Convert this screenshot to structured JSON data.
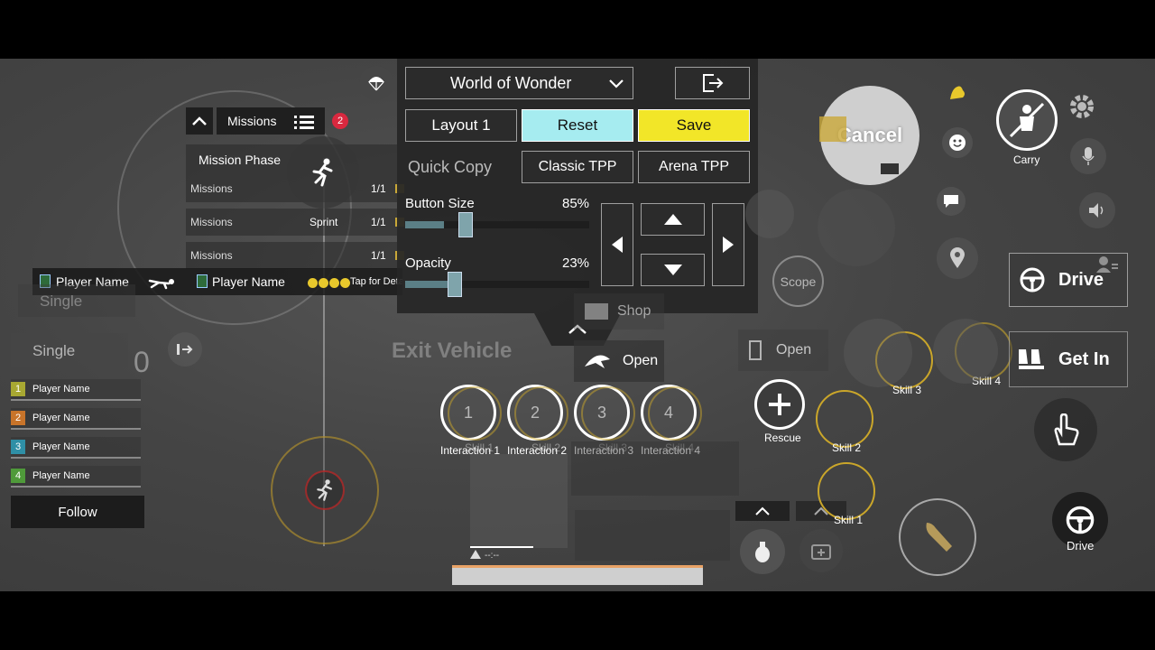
{
  "panel": {
    "map_select": "World of Wonder",
    "layout_label": "Layout 1",
    "reset_label": "Reset",
    "save_label": "Save",
    "quick_copy_label": "Quick Copy",
    "classic_tpp_label": "Classic TPP",
    "arena_tpp_label": "Arena TPP",
    "button_size_label": "Button Size",
    "button_size_value": "85%",
    "button_size_fraction": 0.85,
    "opacity_label": "Opacity",
    "opacity_value": "23%",
    "opacity_fraction": 0.23
  },
  "missions": {
    "tab_label": "Missions",
    "badge_count": "2",
    "phase_label": "Mission Phase",
    "rows": [
      {
        "label": "Missions",
        "progress": "1/1"
      },
      {
        "label": "Missions",
        "progress": "1/1"
      },
      {
        "label": "Missions",
        "progress": "1/1"
      }
    ],
    "sprint_label": "Sprint"
  },
  "teammates": {
    "top_left_name": "Player Name",
    "top_right_name": "Player Name",
    "tap_details": "Tap for Deta",
    "list": [
      {
        "num": "1",
        "name": "Player Name",
        "color": "#a8a832"
      },
      {
        "num": "2",
        "name": "Player Name",
        "color": "#c8742a"
      },
      {
        "num": "3",
        "name": "Player Name",
        "color": "#2f8fa6"
      },
      {
        "num": "4",
        "name": "Player Name",
        "color": "#4f9a3a"
      }
    ],
    "follow_label": "Follow"
  },
  "left_controls": {
    "single_top": "Single",
    "single_bottom": "Single",
    "ammo_count": "0"
  },
  "center": {
    "shop_label": "Shop",
    "open_label": "Open",
    "open_door_label": "Open",
    "exit_vehicle_label": "Exit Vehicle",
    "interactions": [
      {
        "num": "1",
        "label": "Interaction 1",
        "ghost": "Skill 1"
      },
      {
        "num": "2",
        "label": "Interaction 2",
        "ghost": "Skill 2"
      },
      {
        "num": "3",
        "label": "Interaction 3",
        "ghost": "Skill 3"
      },
      {
        "num": "4",
        "label": "Interaction 4",
        "ghost": "Skill 4"
      }
    ],
    "rescue_label": "Rescue",
    "status_text": "--:--"
  },
  "right": {
    "cancel_label": "Cancel",
    "carry_label": "Carry",
    "scope_label": "Scope",
    "drive_label": "Drive",
    "get_in_label": "Get In",
    "drive_small_label": "Drive",
    "skills": [
      {
        "label": "Skill 1"
      },
      {
        "label": "Skill 2"
      },
      {
        "label": "Skill 3"
      },
      {
        "label": "Skill 4"
      }
    ]
  },
  "colors": {
    "reset_bg": "#a6ecf0",
    "save_bg": "#f2e628",
    "skill_ring": "#caa62a",
    "badge_red": "#d9283f"
  }
}
